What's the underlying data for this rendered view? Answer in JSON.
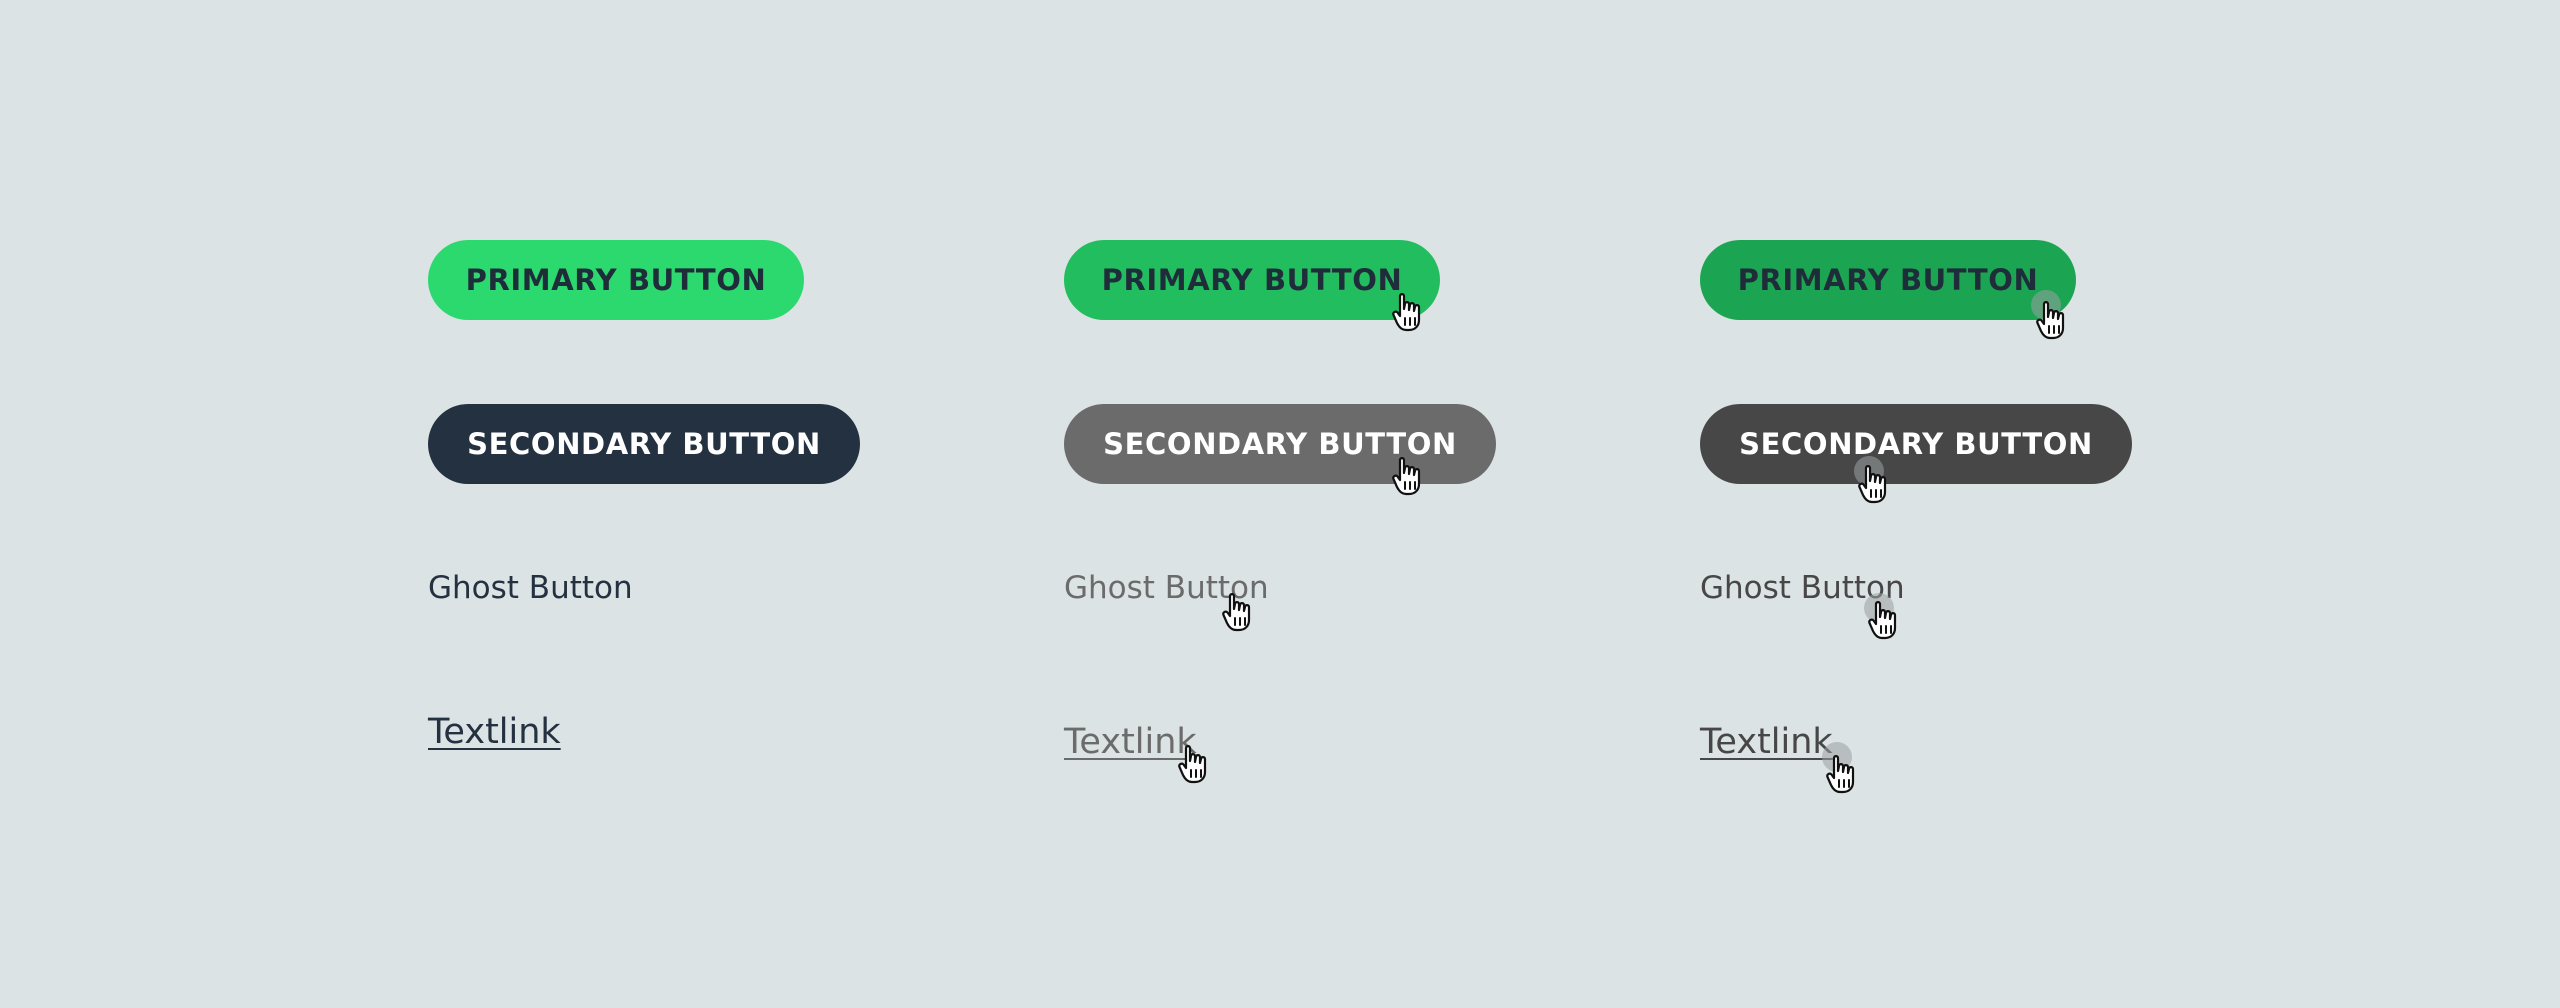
{
  "colors": {
    "background": "#dce3e5",
    "primary_default": "#2bd96f",
    "primary_hover": "#22bd5f",
    "primary_pressed": "#1ba553",
    "secondary_default": "#243140",
    "secondary_hover": "#6b6b6b",
    "secondary_pressed": "#474747",
    "text_default": "#243140",
    "text_hover": "#6b6b6b",
    "text_pressed": "#474747"
  },
  "states": [
    {
      "primary_label": "PRIMARY BUTTON",
      "secondary_label": "SECONDARY BUTTON",
      "ghost_label": "Ghost Button",
      "textlink_label": "Textlink"
    },
    {
      "primary_label": "PRIMARY BUTTON",
      "secondary_label": "SECONDARY BUTTON",
      "ghost_label": "Ghost Button",
      "textlink_label": "Textlink",
      "cursor_icon": "hand-pointer-icon"
    },
    {
      "primary_label": "PRIMARY BUTTON",
      "secondary_label": "SECONDARY BUTTON",
      "ghost_label": "Ghost Button",
      "textlink_label": "Textlink",
      "cursor_icon": "hand-pointer-icon",
      "click_indicator": "click-dot"
    }
  ]
}
